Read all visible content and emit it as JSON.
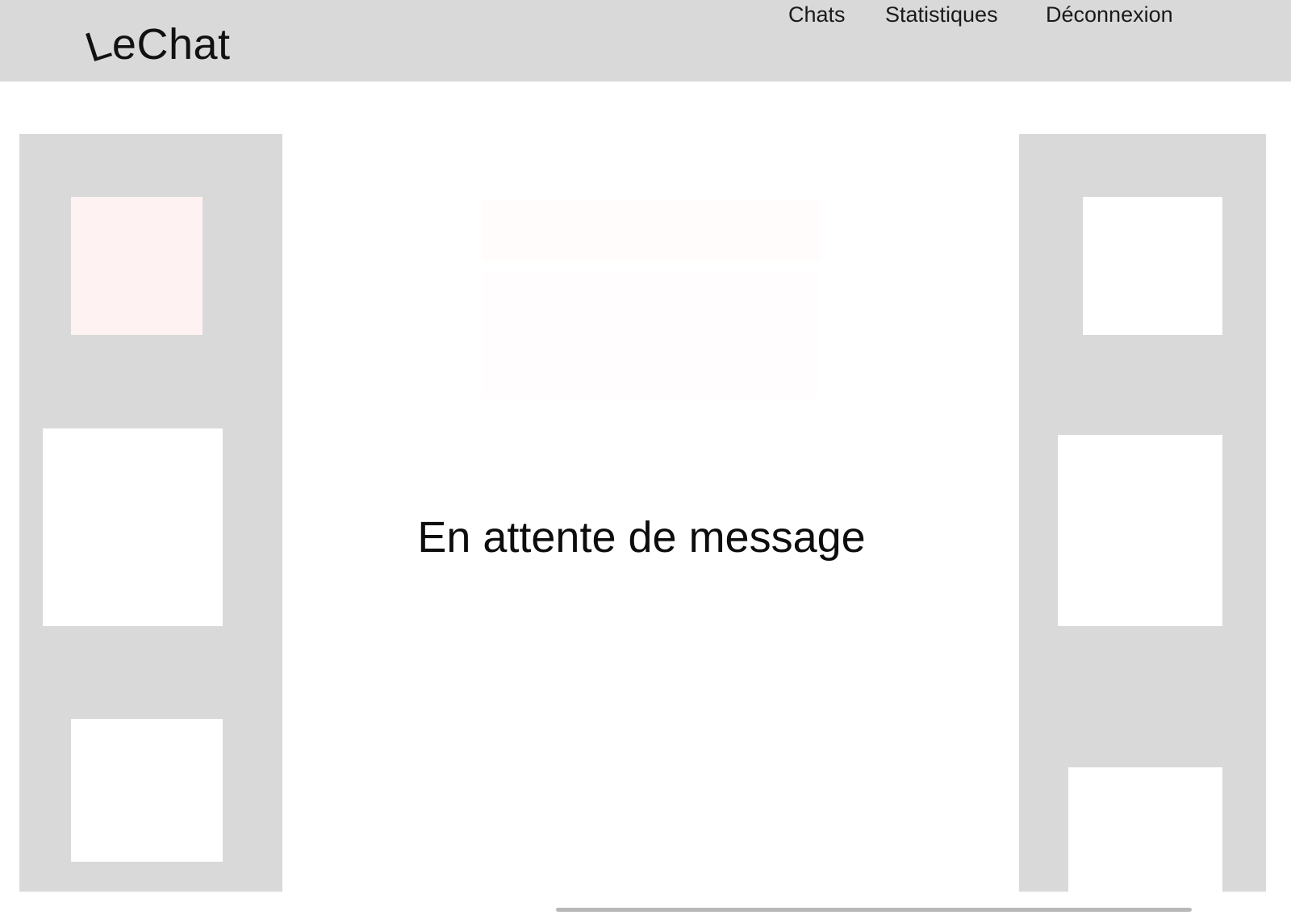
{
  "header": {
    "logo": {
      "first_letter": "L",
      "rest": "eChat"
    },
    "nav": {
      "chats": "Chats",
      "statistics": "Statistiques",
      "logout": "Déconnexion"
    }
  },
  "main": {
    "waiting_text": "En attente de message"
  },
  "colors": {
    "header_bg": "#d9d9d9",
    "panel_bg": "#d9d9d9",
    "selected_card": "#fff2f2",
    "card": "#ffffff"
  }
}
